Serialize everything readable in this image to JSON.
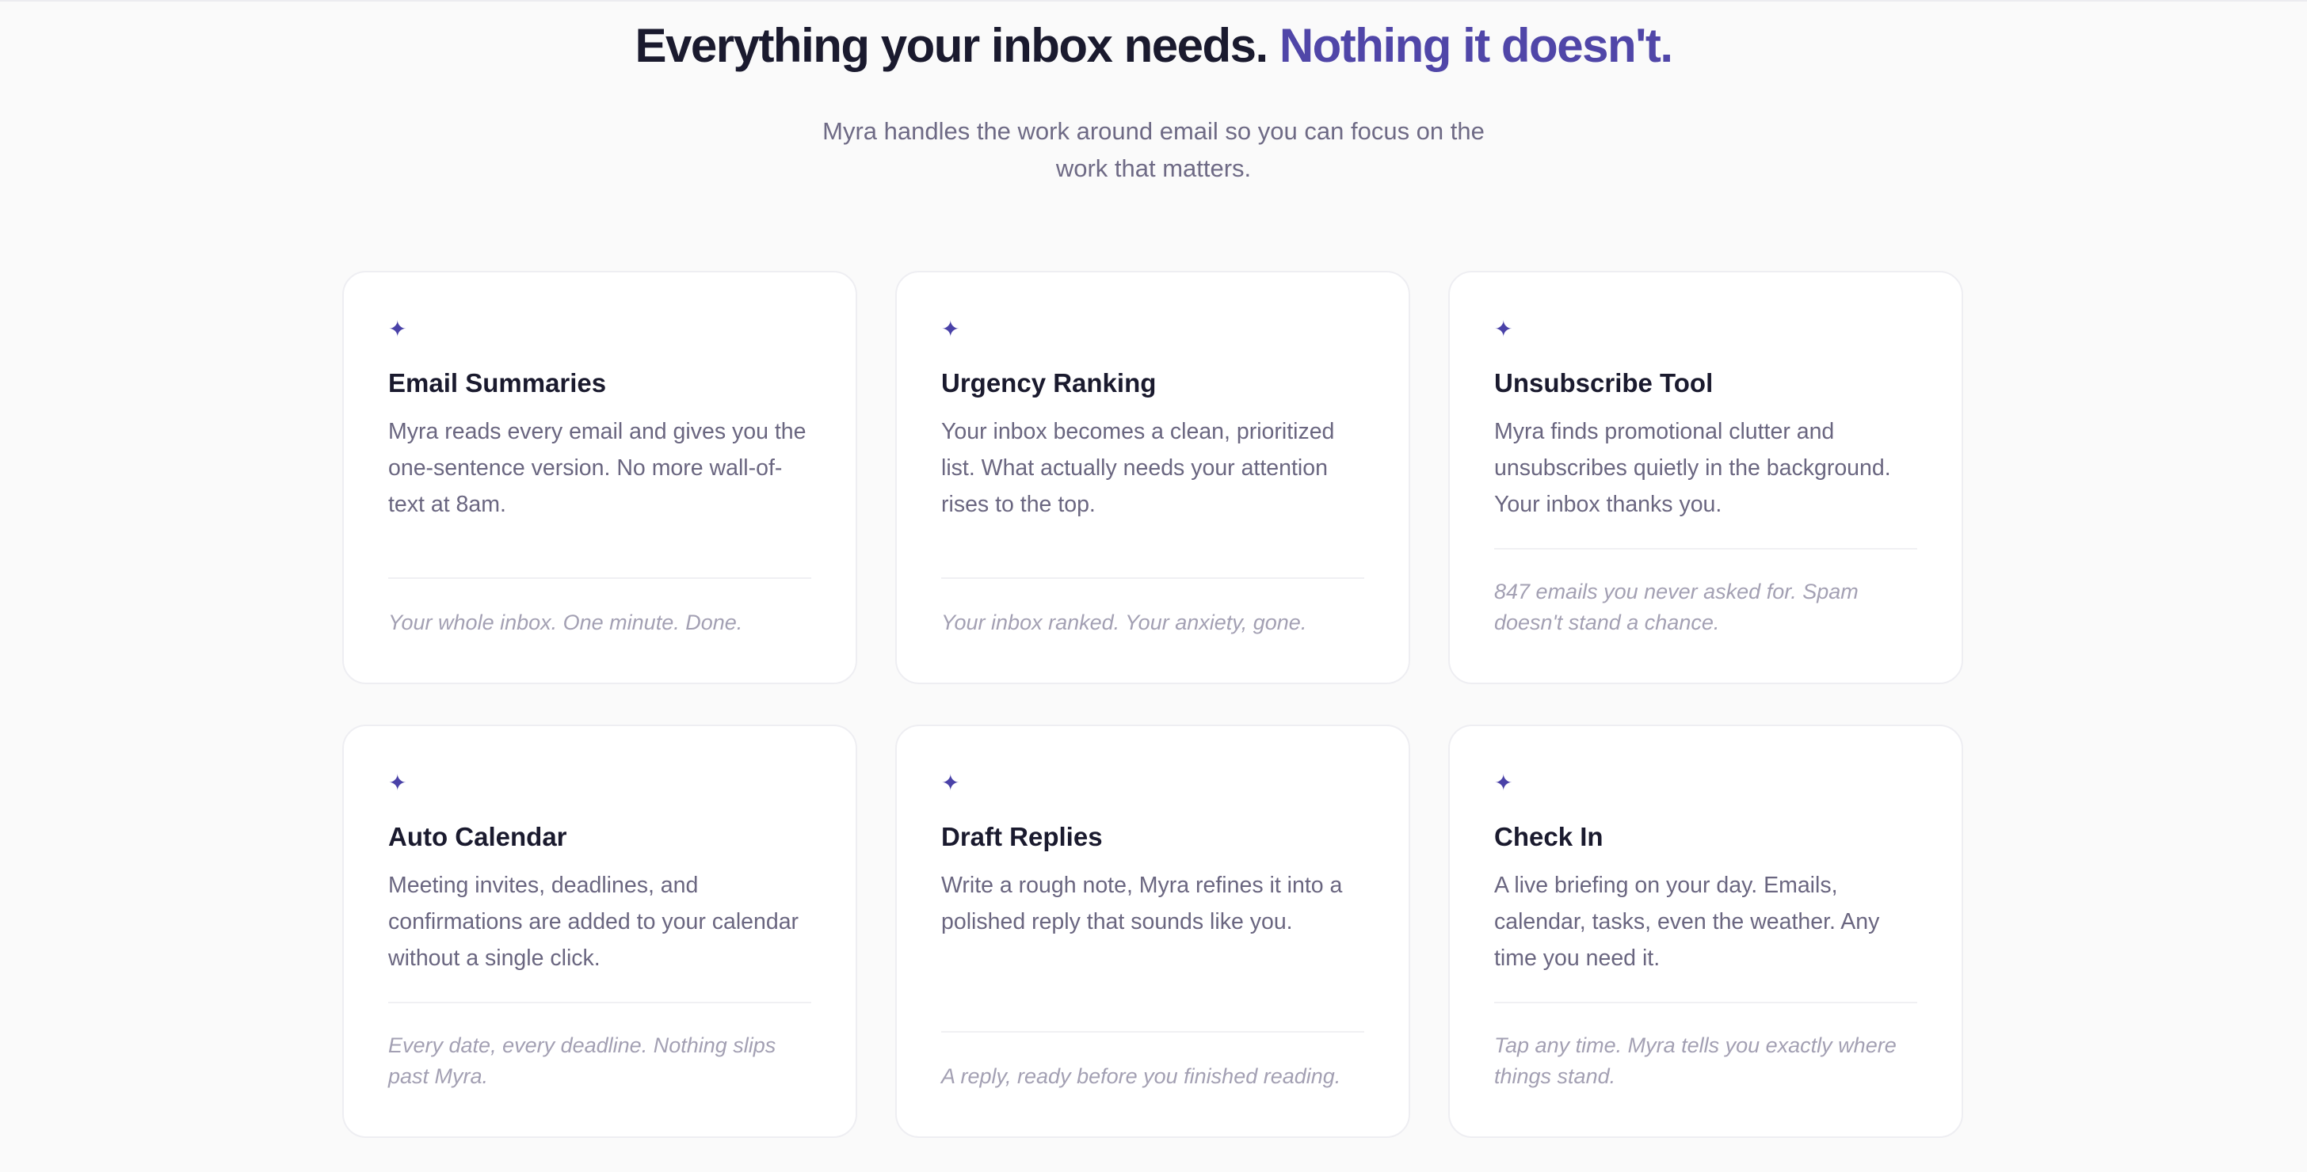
{
  "hero": {
    "headline_main": "Everything your inbox needs.",
    "headline_accent": "Nothing it doesn't.",
    "subhead": "Myra handles the work around email so you can focus on the work that matters."
  },
  "icons": {
    "feature_icon": "sparkle-icon",
    "glyph": "✦"
  },
  "colors": {
    "accent": "#5046a8",
    "heading": "#1a1a2e",
    "body_text": "#6a6680",
    "tagline": "#a3a0b3",
    "background": "#fafafa",
    "card": "#ffffff"
  },
  "features": [
    {
      "title": "Email Summaries",
      "description": "Myra reads every email and gives you the one-sentence version. No more wall-of-text at 8am.",
      "tagline": "Your whole inbox. One minute. Done."
    },
    {
      "title": "Urgency Ranking",
      "description": "Your inbox becomes a clean, prioritized list. What actually needs your attention rises to the top.",
      "tagline": "Your inbox ranked. Your anxiety, gone."
    },
    {
      "title": "Unsubscribe Tool",
      "description": "Myra finds promotional clutter and unsubscribes quietly in the background. Your inbox thanks you.",
      "tagline": "847 emails you never asked for. Spam doesn't stand a chance."
    },
    {
      "title": "Auto Calendar",
      "description": "Meeting invites, deadlines, and confirmations are added to your calendar without a single click.",
      "tagline": "Every date, every deadline. Nothing slips past Myra."
    },
    {
      "title": "Draft Replies",
      "description": "Write a rough note, Myra refines it into a polished reply that sounds like you.",
      "tagline": "A reply, ready before you finished reading."
    },
    {
      "title": "Check In",
      "description": "A live briefing on your day. Emails, calendar, tasks, even the weather. Any time you need it.",
      "tagline": "Tap any time. Myra tells you exactly where things stand."
    }
  ]
}
